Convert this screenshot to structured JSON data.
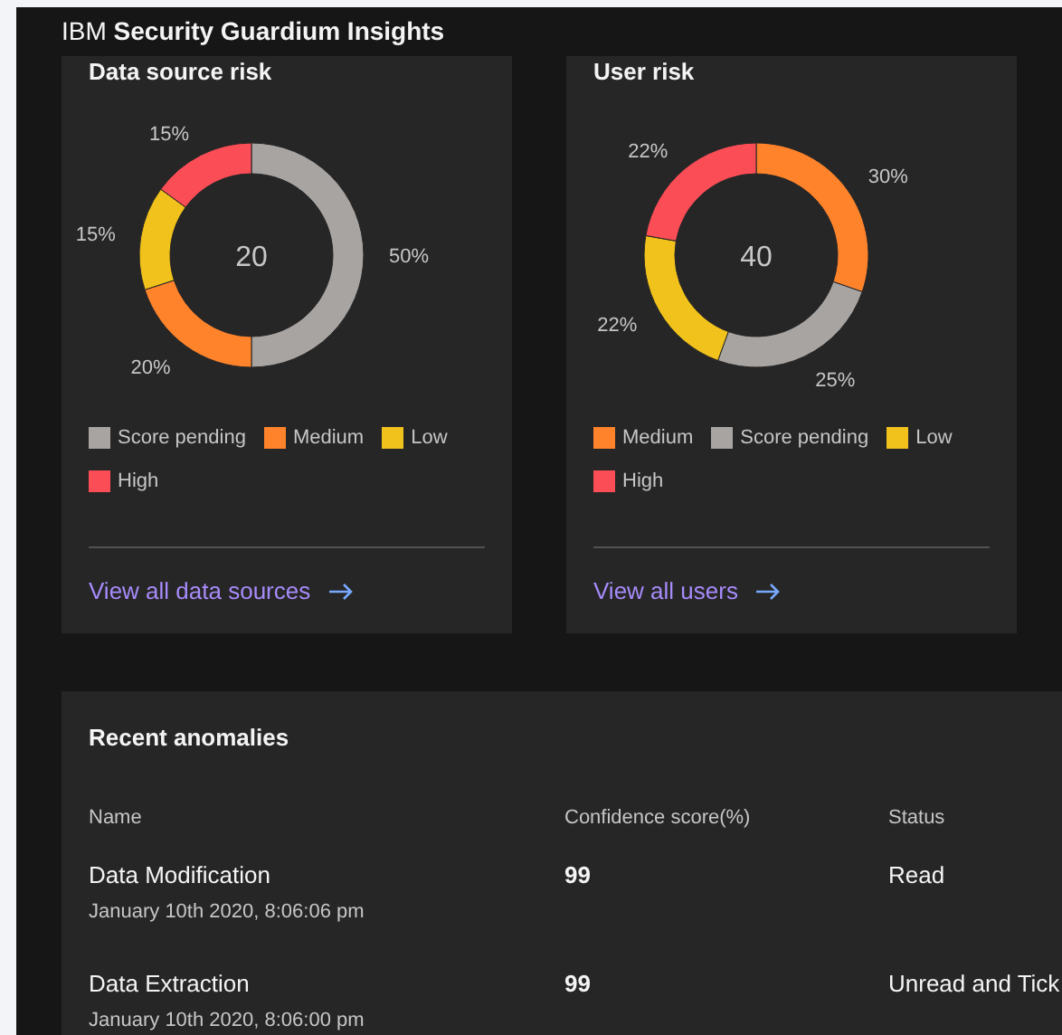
{
  "header": {
    "brand": "IBM",
    "product": "Security Guardium Insights"
  },
  "risk_cards": [
    {
      "title": "Data source risk",
      "total": "20",
      "chart_data": {
        "type": "donut",
        "categories": [
          "Score pending",
          "Medium",
          "Low",
          "High"
        ],
        "values": [
          50,
          20,
          15,
          15
        ],
        "colors": [
          "#a8a4a2",
          "#ff832b",
          "#f1c21b",
          "#fa4d56"
        ],
        "value_labels": [
          "50%",
          "20%",
          "15%",
          "15%"
        ]
      },
      "link": "View all data sources"
    },
    {
      "title": "User risk",
      "total": "40",
      "chart_data": {
        "type": "donut",
        "categories": [
          "Medium",
          "Score pending",
          "Low",
          "High"
        ],
        "values": [
          30,
          25,
          22,
          22
        ],
        "colors": [
          "#ff832b",
          "#a8a4a2",
          "#f1c21b",
          "#fa4d56"
        ],
        "value_labels": [
          "30%",
          "25%",
          "22%",
          "22%"
        ]
      },
      "link": "View all users"
    }
  ],
  "anomalies": {
    "title": "Recent anomalies",
    "columns": [
      "Name",
      "Confidence score(%)",
      "Status"
    ],
    "rows": [
      {
        "name": "Data Modification",
        "time": "January 10th 2020, 8:06:06 pm",
        "score": "99",
        "status": "Read"
      },
      {
        "name": "Data Extraction",
        "time": "January 10th 2020, 8:06:00 pm",
        "score": "99",
        "status": "Unread and Tick"
      }
    ]
  }
}
